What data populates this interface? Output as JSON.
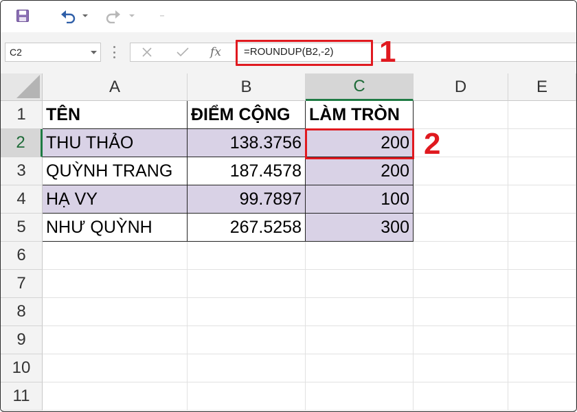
{
  "toolbar": {
    "save_icon": "save-icon",
    "undo_icon": "undo-icon",
    "redo_icon": "redo-icon"
  },
  "formula_bar": {
    "name_box": "C2",
    "formula": "=ROUNDUP(B2,-2)",
    "fx_label": "fx"
  },
  "annotations": {
    "marker1": "1",
    "marker2": "2",
    "highlight_color": "#e0191f"
  },
  "sheet": {
    "columns": [
      "A",
      "B",
      "C",
      "D",
      "E"
    ],
    "selected_column": "C",
    "rows": [
      "1",
      "2",
      "3",
      "4",
      "5",
      "6",
      "7",
      "8",
      "9",
      "10",
      "11"
    ],
    "selected_row": "2",
    "header": {
      "a": "TÊN",
      "b": "ĐIỂM CỘNG",
      "c": "LÀM TRÒN"
    },
    "data": [
      {
        "name": "THU THẢO",
        "score": "138.3756",
        "rounded": "200"
      },
      {
        "name": "QUỲNH TRANG",
        "score": "187.4578",
        "rounded": "200"
      },
      {
        "name": "HẠ VY",
        "score": "99.7897",
        "rounded": "100"
      },
      {
        "name": "NHƯ QUỲNH",
        "score": "267.5258",
        "rounded": "300"
      }
    ],
    "shade_color": "#d9d2e6"
  }
}
